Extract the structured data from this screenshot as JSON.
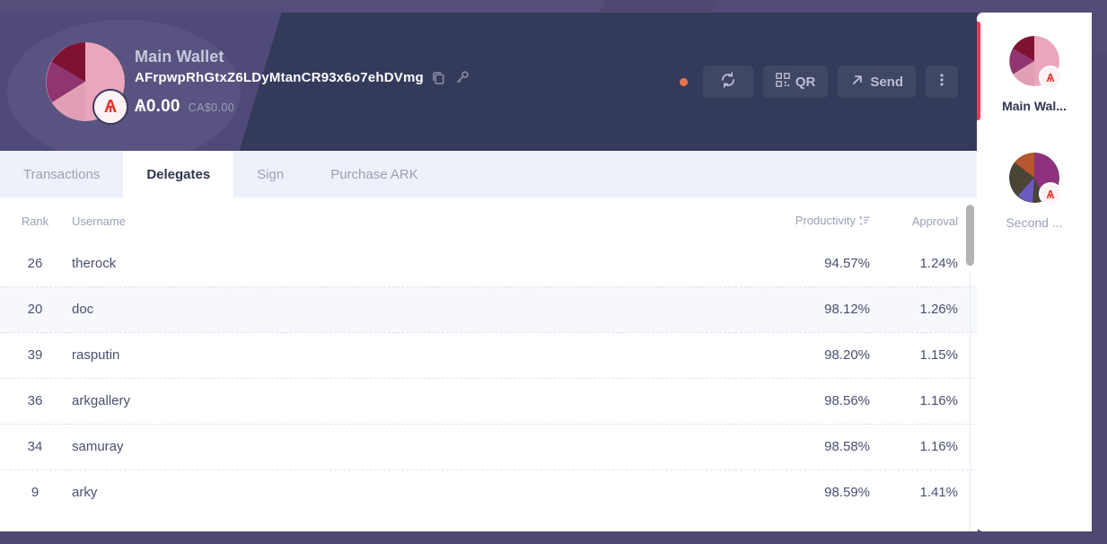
{
  "header": {
    "wallet_name": "Main Wallet",
    "address": "AFrpwpRhGtxZ6LDyMtanCR93x6o7ehDVmg",
    "copy_icon": "copy-icon",
    "key_icon": "key-icon",
    "balance": "Ѧ0.00",
    "balance_fiat": "CA$0.00",
    "status_dot_color": "#e8744f",
    "actions": {
      "refresh_label": "",
      "qr_label": "QR",
      "send_label": "Send",
      "more_label": ""
    }
  },
  "tabs": [
    {
      "label": "Transactions",
      "active": false
    },
    {
      "label": "Delegates",
      "active": true
    },
    {
      "label": "Sign",
      "active": false
    },
    {
      "label": "Purchase ARK",
      "active": false
    }
  ],
  "table": {
    "columns": [
      "Rank",
      "Username",
      "Productivity",
      "Approval"
    ],
    "sort_column": "Productivity",
    "sort_direction": "ascending",
    "rows": [
      {
        "rank": "26",
        "username": "therock",
        "productivity": "94.57%",
        "approval": "1.24%",
        "highlighted": false
      },
      {
        "rank": "20",
        "username": "doc",
        "productivity": "98.12%",
        "approval": "1.26%",
        "highlighted": true
      },
      {
        "rank": "39",
        "username": "rasputin",
        "productivity": "98.20%",
        "approval": "1.15%",
        "highlighted": false
      },
      {
        "rank": "36",
        "username": "arkgallery",
        "productivity": "98.56%",
        "approval": "1.16%",
        "highlighted": false
      },
      {
        "rank": "34",
        "username": "samuray",
        "productivity": "98.58%",
        "approval": "1.16%",
        "highlighted": false
      },
      {
        "rank": "9",
        "username": "arky",
        "productivity": "98.59%",
        "approval": "1.41%",
        "highlighted": false
      }
    ]
  },
  "sidebar": {
    "wallets": [
      {
        "label": "Main Wal...",
        "active": true
      },
      {
        "label": "Second ...",
        "active": false
      }
    ]
  },
  "colors": {
    "page_background": "#4e4873",
    "header_card": "#343a5a",
    "tabbar": "#eef1f9",
    "accent_active": "#f5325b",
    "status": "#e8744f",
    "ark_red": "#e5322c"
  }
}
